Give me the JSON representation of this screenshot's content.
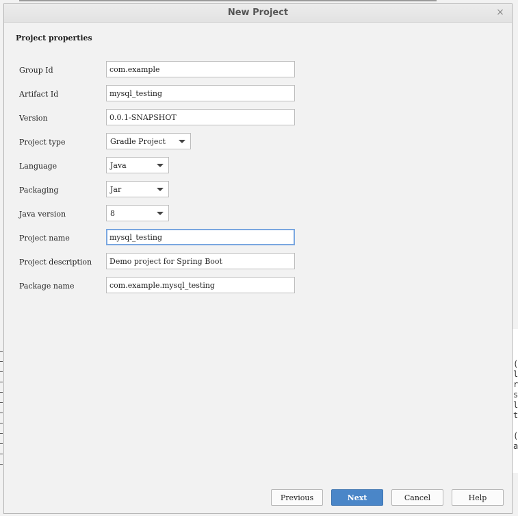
{
  "dialog": {
    "title": "New Project",
    "close_glyph": "×"
  },
  "section_title": "Project properties",
  "fields": {
    "group_id": {
      "label": "Group Id",
      "value": "com.example"
    },
    "artifact_id": {
      "label": "Artifact Id",
      "value": "mysql_testing"
    },
    "version": {
      "label": "Version",
      "value": "0.0.1-SNAPSHOT"
    },
    "project_type": {
      "label": "Project type",
      "value": "Gradle Project"
    },
    "language": {
      "label": "Language",
      "value": "Java"
    },
    "packaging": {
      "label": "Packaging",
      "value": "Jar"
    },
    "java_version": {
      "label": "Java version",
      "value": "8"
    },
    "project_name": {
      "label": "Project name",
      "value": "mysql_testing"
    },
    "project_description": {
      "label": "Project description",
      "value": "Demo project for Spring Boot"
    },
    "package_name": {
      "label": "Package name",
      "value": "com.example.mysql_testing"
    }
  },
  "buttons": {
    "previous": "Previous",
    "next": "Next",
    "cancel": "Cancel",
    "help": "Help"
  },
  "background_editor_chars": [
    "(",
    "l",
    "r",
    "s",
    "l",
    "t",
    "",
    "(",
    "a"
  ],
  "colors": {
    "primary_button": "#4a86c8",
    "focus_border": "#7aa7e0"
  }
}
